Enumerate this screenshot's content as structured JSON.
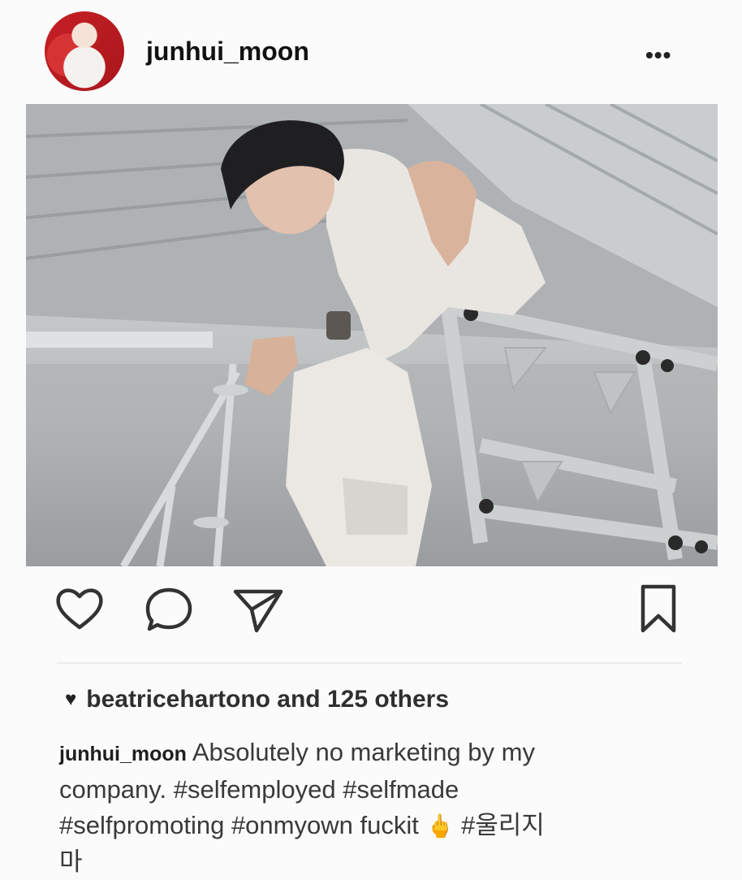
{
  "post": {
    "username": "junhui_moon",
    "more_icon": "more-horizontal-icon",
    "more_label": "•••"
  },
  "actions": {
    "like_icon": "heart-outline-icon",
    "comment_icon": "comment-bubble-icon",
    "share_icon": "send-paper-plane-icon",
    "save_icon": "bookmark-icon"
  },
  "likes": {
    "heart_glyph": "♥",
    "text": "beatricehartono and 125 others"
  },
  "caption": {
    "username": "junhui_moon",
    "text_line1": "Absolutely no marketing by my",
    "text_line2": "company. #selfemployed #selfmade",
    "text_line3a": "#selfpromoting #onmyown fuckit",
    "emoji": "🖕",
    "text_line3b": "#울리지",
    "text_line4": "마"
  }
}
